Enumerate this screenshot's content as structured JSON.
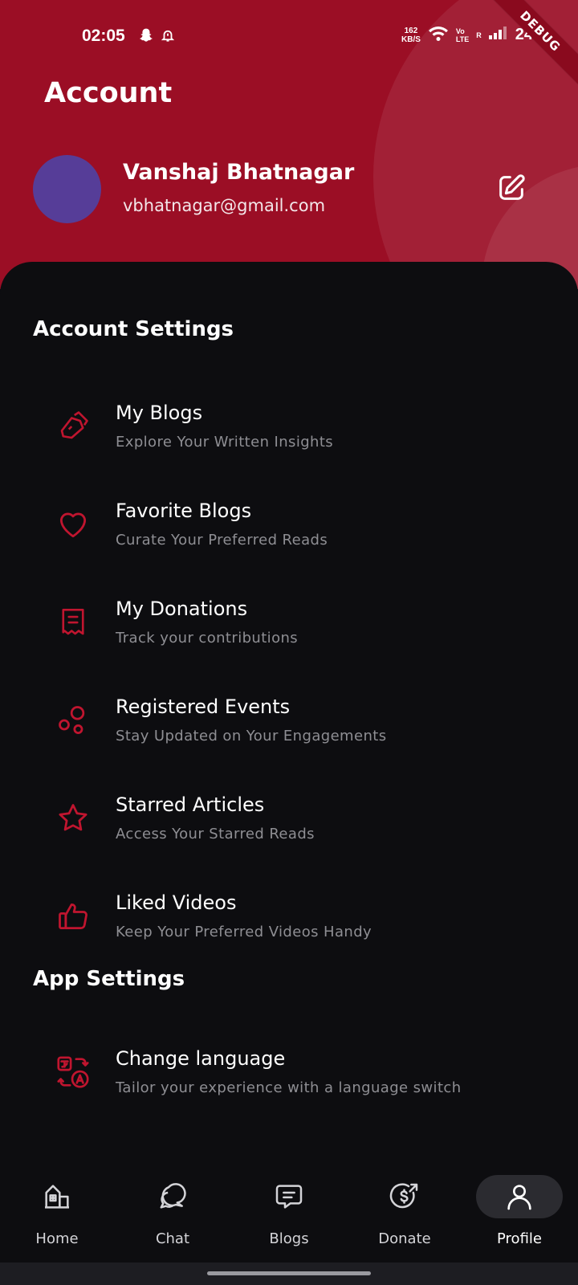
{
  "status_bar": {
    "time": "02:05",
    "speed_value": "162",
    "speed_unit": "KB/S",
    "volte_top": "Vo",
    "volte_bottom": "LTE",
    "roaming": "R",
    "battery": "24%",
    "icons": [
      "snapchat-icon",
      "alarm-icon",
      "wifi-icon",
      "signal-icon"
    ]
  },
  "debug_banner": "DEBUG",
  "header": {
    "title": "Account",
    "user_name": "Vanshaj Bhatnagar",
    "user_email": "vbhatnagar@gmail.com"
  },
  "colors": {
    "brand": "#9b0e25",
    "accent_icon": "#c0152f",
    "avatar": "#563d98",
    "background": "#0d0d10"
  },
  "account_settings": {
    "title": "Account Settings",
    "items": [
      {
        "title": "My Blogs",
        "subtitle": "Explore Your Written Insights",
        "icon": "pen-icon"
      },
      {
        "title": "Favorite Blogs",
        "subtitle": "Curate Your Preferred Reads",
        "icon": "heart-icon"
      },
      {
        "title": "My Donations",
        "subtitle": "Track your contributions",
        "icon": "receipt-icon"
      },
      {
        "title": "Registered Events",
        "subtitle": "Stay Updated on Your Engagements",
        "icon": "bubbles-icon"
      },
      {
        "title": "Starred Articles",
        "subtitle": "Access Your Starred Reads",
        "icon": "star-icon"
      },
      {
        "title": "Liked Videos",
        "subtitle": "Keep Your Preferred Videos Handy",
        "icon": "thumbs-up-icon"
      }
    ]
  },
  "app_settings": {
    "title": "App Settings",
    "items": [
      {
        "title": "Change language",
        "subtitle": "Tailor your experience with a language switch",
        "icon": "translate-icon"
      }
    ]
  },
  "bottom_nav": {
    "items": [
      {
        "label": "Home",
        "icon": "home-icon"
      },
      {
        "label": "Chat",
        "icon": "chat-icon"
      },
      {
        "label": "Blogs",
        "icon": "blogs-icon"
      },
      {
        "label": "Donate",
        "icon": "donate-icon"
      },
      {
        "label": "Profile",
        "icon": "profile-icon"
      }
    ],
    "active": "Profile"
  }
}
